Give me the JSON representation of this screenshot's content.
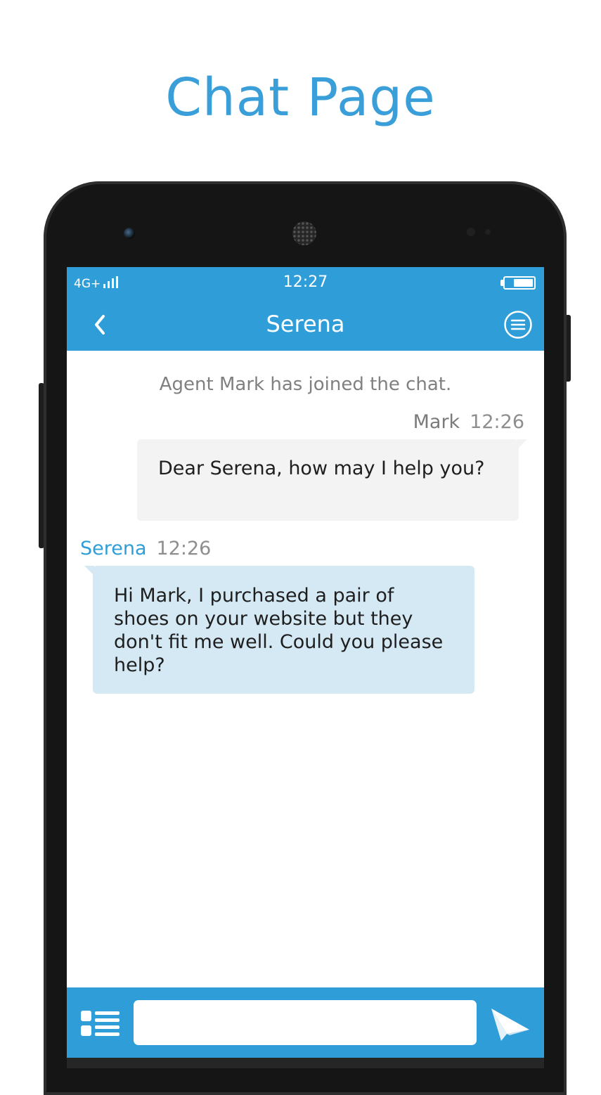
{
  "page": {
    "title": "Chat Page"
  },
  "status_bar": {
    "network": "4G+",
    "time": "12:27",
    "battery_level": 0.65
  },
  "header": {
    "title": "Serena",
    "back_icon": "chevron-left-icon",
    "menu_icon": "menu-circle-icon"
  },
  "chat": {
    "system_message": "Agent Mark has joined the chat.",
    "messages": [
      {
        "sender": "Mark",
        "time": "12:26",
        "text": "Dear Serena, how may I help you?"
      },
      {
        "sender": "Serena",
        "time": "12:26",
        "text": "Hi Mark, I purchased a pair of shoes on your website but they don't fit me well. Could you please help?"
      }
    ]
  },
  "input_bar": {
    "value": "",
    "placeholder": "",
    "menu_icon": "quick-menu-icon",
    "send_icon": "paper-plane-icon"
  },
  "colors": {
    "accent": "#2f9ed8",
    "title": "#3a9fd9",
    "agent_bubble": "#f3f3f3",
    "user_bubble": "#d5e9f5"
  }
}
